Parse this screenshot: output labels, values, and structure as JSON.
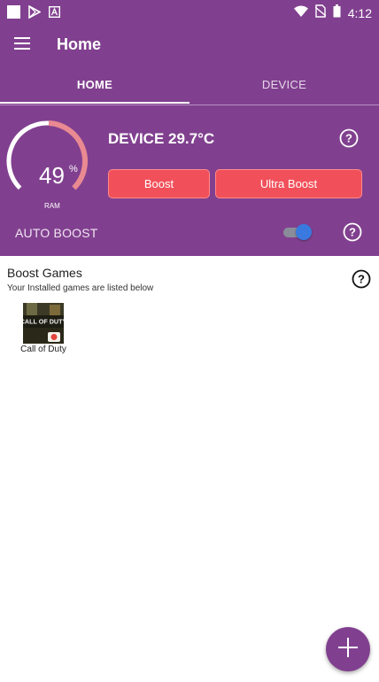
{
  "status_bar": {
    "time": "4:12",
    "left_icons": [
      "square-notification-icon",
      "play-store-icon",
      "text-notification-icon"
    ],
    "right_icons": [
      "wifi-icon",
      "no-sim-icon",
      "battery-icon"
    ]
  },
  "toolbar": {
    "title": "Home",
    "menu_icon": "menu-icon"
  },
  "tabs": [
    {
      "label": "HOME",
      "selected": true
    },
    {
      "label": "DEVICE",
      "selected": false
    }
  ],
  "ram_gauge": {
    "value": "49",
    "unit": "%",
    "label": "RAM",
    "fraction": 0.49
  },
  "device": {
    "temperature": "DEVICE 29.7°C"
  },
  "buttons": {
    "boost": "Boost",
    "ultra_boost": "Ultra Boost"
  },
  "auto_boost": {
    "label": "AUTO BOOST",
    "enabled": true
  },
  "boost_games": {
    "title": "Boost Games",
    "subtitle": "Your Installed games are listed below",
    "games": [
      {
        "name": "Call of Duty",
        "icon_text": "CALL OF DUTY"
      }
    ]
  },
  "fab": {
    "icon": "plus-icon"
  },
  "colors": {
    "primary": "#81408f",
    "accent_red": "#f1505a",
    "gauge_track": "#ffffff",
    "gauge_progress": "#e98a92",
    "toggle_thumb": "#3a7ae0"
  }
}
